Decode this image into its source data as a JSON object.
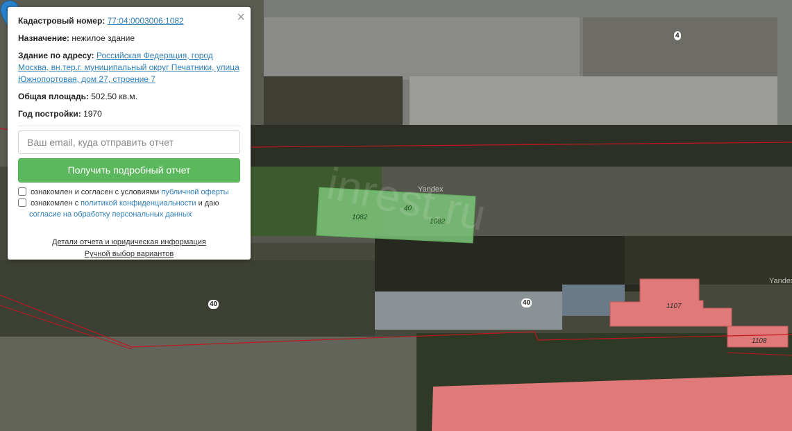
{
  "map": {
    "plot_labels": {
      "selected_plot_a": "1082",
      "selected_plot_b": "1082",
      "badge_selected": "40",
      "plot_1107": "1107",
      "plot_1108": "1108",
      "badge_left": "40",
      "badge_center": "40",
      "badge_top": "4"
    },
    "watermarks": {
      "yandex_center": "Yandex",
      "yandex_right": "Yandex",
      "site": "inrest.ru"
    },
    "colors": {
      "selected_fill": "#7cc47a",
      "plot_fill": "#e07a7a",
      "boundary_line": "#c0161e"
    }
  },
  "popup": {
    "close_glyph": "×",
    "cadastral_label": "Кадастровый номер:",
    "cadastral_value": "77:04:0003006:1082",
    "purpose_label": "Назначение:",
    "purpose_value": "нежилое здание",
    "address_label": "Здание по адресу:",
    "address_value": "Российская Федерация, город Москва, вн.тер.г. муниципальный округ Печатники, улица Южнопортовая, дом 27, строение 7",
    "area_label": "Общая площадь:",
    "area_value": "502.50 кв.м.",
    "year_label": "Год постройки:",
    "year_value": "1970",
    "email_placeholder": "Ваш email, куда отправить отчет",
    "submit_label": "Получить подробный отчет",
    "consent1_text": "ознакомлен и согласен с условиями",
    "consent1_link": "публичной оферты",
    "consent2_text": "ознакомлен с",
    "consent2_link": "политикой конфиденциальности",
    "consent2_and": "и даю",
    "consent2_link2": "согласие на обработку персональных данных",
    "details_link": "Детали отчета и юридическая информация",
    "manual_link": "Ручной выбор вариантов",
    "accent_color": "#5cb85c"
  }
}
